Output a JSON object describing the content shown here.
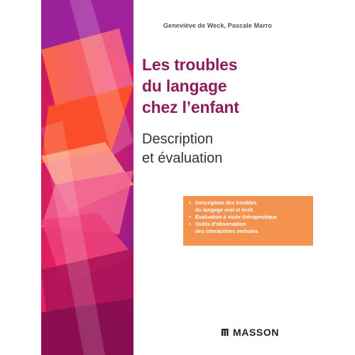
{
  "cover": {
    "authors": "Geneviève de Weck, Pascale Marro",
    "title_lines": [
      "Les troubles",
      "du langage",
      "chez l’enfant"
    ],
    "subtitle_lines": [
      "Description",
      "et évaluation"
    ],
    "bullets": [
      {
        "lines": [
          "Description des troubles",
          "du langage oral et écrit"
        ]
      },
      {
        "lines": [
          "Évaluation à visée thérapeutique"
        ]
      },
      {
        "lines": [
          "Outils d’observation",
          "des interactions verbales"
        ]
      }
    ],
    "bullet_symbol": "•",
    "publisher": "MASSON",
    "publisher_logo": "masson-logo-icon",
    "colors": {
      "title": "#8c1f5a",
      "subtitle": "#333333",
      "authors": "#555555",
      "bullet_box": "#f4924f",
      "bullet_text": "#ffffff"
    }
  }
}
